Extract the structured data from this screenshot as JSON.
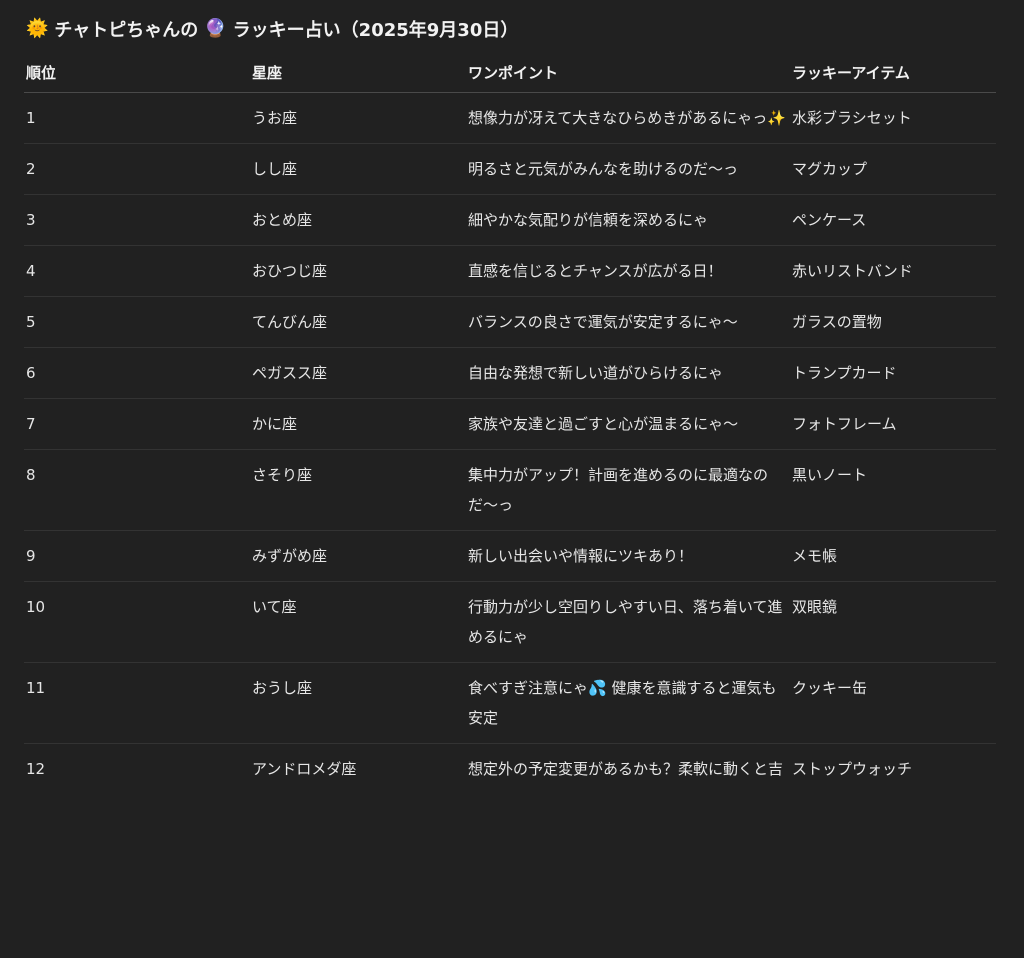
{
  "title": {
    "icon_sun": "🌞",
    "part1": "チャトピちゃんの",
    "icon_crystal": "🔮",
    "part2": "ラッキー占い（2025年9月30日）"
  },
  "columns": [
    "順位",
    "星座",
    "ワンポイント",
    "ラッキーアイテム"
  ],
  "rows": [
    {
      "rank": "1",
      "sign": "うお座",
      "tip": "想像力が冴えて大きなひらめきがあるにゃっ✨",
      "item": "水彩ブラシセット"
    },
    {
      "rank": "2",
      "sign": "しし座",
      "tip": "明るさと元気がみんなを助けるのだ〜っ",
      "item": "マグカップ"
    },
    {
      "rank": "3",
      "sign": "おとめ座",
      "tip": "細やかな気配りが信頼を深めるにゃ",
      "item": "ペンケース"
    },
    {
      "rank": "4",
      "sign": "おひつじ座",
      "tip": "直感を信じるとチャンスが広がる日！",
      "item": "赤いリストバンド"
    },
    {
      "rank": "5",
      "sign": "てんびん座",
      "tip": "バランスの良さで運気が安定するにゃ〜",
      "item": "ガラスの置物"
    },
    {
      "rank": "6",
      "sign": "ペガスス座",
      "tip": "自由な発想で新しい道がひらけるにゃ",
      "item": "トランプカード"
    },
    {
      "rank": "7",
      "sign": "かに座",
      "tip": "家族や友達と過ごすと心が温まるにゃ〜",
      "item": "フォトフレーム"
    },
    {
      "rank": "8",
      "sign": "さそり座",
      "tip": "集中力がアップ！計画を進めるのに最適なのだ〜っ",
      "item": "黒いノート"
    },
    {
      "rank": "9",
      "sign": "みずがめ座",
      "tip": "新しい出会いや情報にツキあり！",
      "item": "メモ帳"
    },
    {
      "rank": "10",
      "sign": "いて座",
      "tip": "行動力が少し空回りしやすい日、落ち着いて進めるにゃ",
      "item": "双眼鏡"
    },
    {
      "rank": "11",
      "sign": "おうし座",
      "tip": "食べすぎ注意にゃ💦 健康を意識すると運気も安定",
      "item": "クッキー缶"
    },
    {
      "rank": "12",
      "sign": "アンドロメダ座",
      "tip": "想定外の予定変更があるかも？柔軟に動くと吉",
      "item": "ストップウォッチ"
    }
  ]
}
